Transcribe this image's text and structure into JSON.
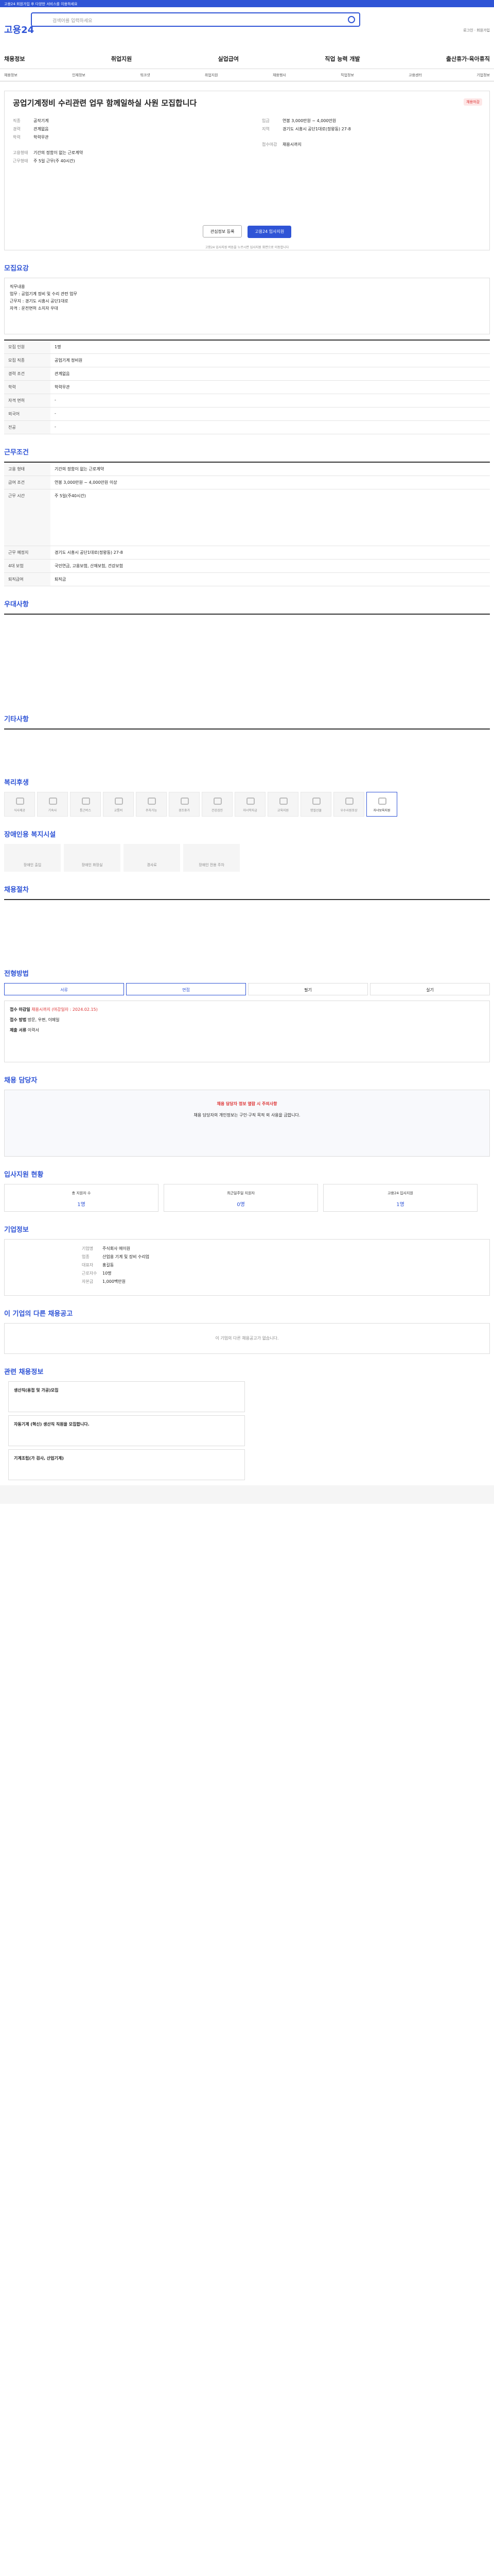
{
  "topbar": {
    "text": "고용24 회원가입 후 다양한 서비스를 이용하세요"
  },
  "header": {
    "logo": "고용24",
    "search_placeholder": "검색어를 입력하세요",
    "right_links": "로그인 · 회원가입"
  },
  "nav": [
    "채용정보",
    "취업지원",
    "실업급여",
    "직업 능력 개발",
    "출산휴가·육아휴직"
  ],
  "subnav": [
    "채용정보",
    "인재정보",
    "워크넷",
    "취업지원",
    "채용행사",
    "직업정보",
    "고용센터",
    "기업정보"
  ],
  "job": {
    "title": "공업기계정비 수리관련 업무 함께일하실 사원 모집합니다",
    "badge": "채용마감",
    "left": [
      [
        "직종",
        "공작기계"
      ],
      [
        "경력",
        "관계없음"
      ],
      [
        "학력",
        "학력무관"
      ],
      [
        "고용형태",
        "기간의 정함이 없는 근로계약"
      ],
      [
        "근무형태",
        "주 5일 근무(주 40시간)"
      ]
    ],
    "right": [
      [
        "임금",
        "연봉 3,000만원 ~ 4,000만원"
      ],
      [
        "지역",
        "경기도 시흥시 공단1대로(정왕동) 27-8"
      ],
      [
        "접수마감",
        "채용시까지"
      ]
    ],
    "btn_scrap": "관심정보 등록",
    "btn_apply": "고용24 입사지원",
    "note": "고용24 입사지원 버튼을 누르시면 입사지원 화면으로 이동합니다"
  },
  "sections": {
    "recruit": "모집요강",
    "work": "근무조건",
    "prefer": "우대사항",
    "other": "기타사항",
    "welfare": "복리후생",
    "disabled": "장애인용 복지시설",
    "contract": "채용절차",
    "apply": "전형방법",
    "manager": "채용 담당자",
    "stats": "입사지원 현황",
    "company": "기업정보",
    "other_jobs": "이 기업의 다른 채용공고",
    "related": "관련 채용정보"
  },
  "recruit_rows": [
    [
      "모집 인원",
      "1명"
    ],
    [
      "모집 직종",
      "공업기계 정비원"
    ],
    [
      "경력 조건",
      "관계없음"
    ],
    [
      "학력",
      "학력무관"
    ],
    [
      "자격 면허",
      "-"
    ],
    [
      "외국어",
      "-"
    ],
    [
      "전공",
      "-"
    ]
  ],
  "recruit_desc": "직무내용\n업무 : 공업기계 정비 및 수리 관련 업무\n근무지 : 경기도 시흥시 공단1대로\n자격 : 운전면허 소지자 우대",
  "work_rows": [
    [
      "고용 형태",
      "기간의 정함이 없는 근로계약"
    ],
    [
      "급여 조건",
      "연봉 3,000만원 ~ 4,000만원 이상"
    ],
    [
      "근무 시간",
      "주 5일(주40시간)"
    ],
    [
      "근무 예정지",
      "경기도 시흥시 공단1대로(정왕동) 27-8"
    ],
    [
      "4대 보험",
      "국민연금, 고용보험, 산재보험, 건강보험"
    ],
    [
      "퇴직급여",
      "퇴직금"
    ]
  ],
  "welfare_icons": [
    "식사제공",
    "기숙사",
    "통근버스",
    "교통비",
    "주차가능",
    "경조휴가",
    "건강검진",
    "자녀학자금",
    "교육지원",
    "명절선물",
    "우수사원포상",
    "자녀보육지원"
  ],
  "disabled_cards": [
    "장애인 출입",
    "장애인 화장실",
    "경사로",
    "장애인 전용 주차"
  ],
  "apply_tabs": [
    "서류",
    "면접",
    "필기",
    "실기"
  ],
  "apply_info": [
    [
      "접수 마감일",
      "채용시까지 (마감일자 : 2024.02.15)"
    ],
    [
      "접수 방법",
      "방문, 우편, 이메일"
    ],
    [
      "제출 서류",
      "이력서"
    ]
  ],
  "manager_note": "채용 담당자 정보 열람 시 주의사항",
  "manager_desc": "채용 담당자의 개인정보는 구인·구직 목적 외 사용을 금합니다.",
  "stats": [
    [
      "총 지원자 수",
      "1명"
    ],
    [
      "최근일주일 지원자",
      "0명"
    ],
    [
      "고용24 입사지원",
      "1명"
    ]
  ],
  "company_rows": [
    [
      "기업명",
      "주식회사 에이원"
    ],
    [
      "업종",
      "산업용 기계 및 장비 수리업"
    ],
    [
      "대표자",
      "홍길동"
    ],
    [
      "근로자수",
      "10명"
    ],
    [
      "자본금",
      "1,000백만원"
    ]
  ],
  "other_jobs_empty": "이 기업의 다른 채용공고가 없습니다.",
  "related_jobs": [
    "생산직(용접 및 가공)모집",
    "자동기계 (혁신) 생산직 직원을 모집합니다.",
    "기계조립(가 검사, 산업기계)"
  ]
}
